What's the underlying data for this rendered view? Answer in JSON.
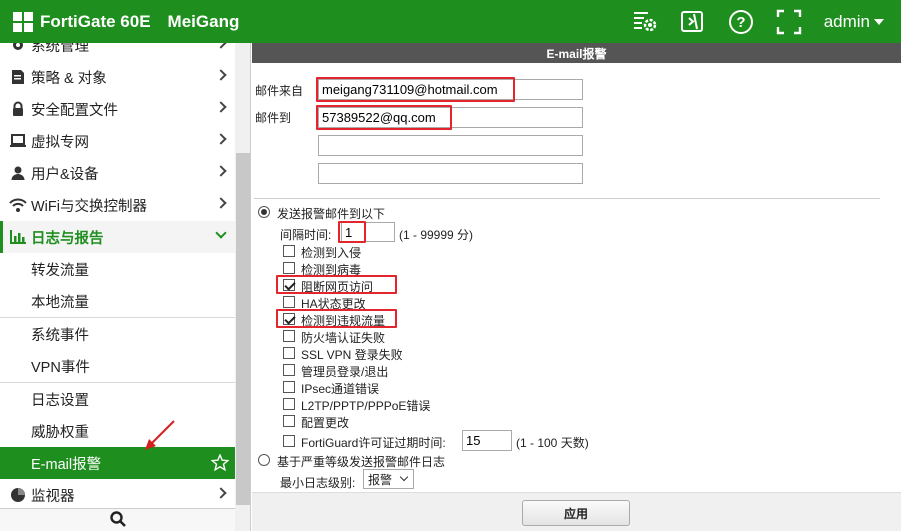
{
  "topbar": {
    "product": "FortiGate 60E",
    "hostname": "MeiGang",
    "icons": [
      "cli-settings-icon",
      "video-icon",
      "help-icon",
      "fullscreen-icon"
    ],
    "user": "admin"
  },
  "sidebar": {
    "items": [
      {
        "label": "系统管理",
        "icon": "gear-icon"
      },
      {
        "label": "策略 & 对象",
        "icon": "policy-icon"
      },
      {
        "label": "安全配置文件",
        "icon": "lock-icon"
      },
      {
        "label": "虚拟专网",
        "icon": "laptop-icon"
      },
      {
        "label": "用户&设备",
        "icon": "user-icon"
      },
      {
        "label": "WiFi与交换控制器",
        "icon": "wifi-icon"
      },
      {
        "label": "日志与报告",
        "icon": "bar-chart-icon"
      }
    ],
    "log_sub": [
      "转发流量",
      "本地流量",
      "系统事件",
      "VPN事件",
      "日志设置",
      "威胁权重",
      "E-mail报警"
    ],
    "monitor": {
      "label": "监视器",
      "icon": "pie-chart-icon"
    }
  },
  "main": {
    "title": "E-mail报警",
    "email_from_label": "邮件来自",
    "email_from": "meigang731109@hotmail.com",
    "email_to_label": "邮件到",
    "email_to": [
      "57389522@qq.com",
      "",
      ""
    ],
    "send_option_label": "发送报警邮件到以下",
    "interval_label": "间隔时间:",
    "interval_value": "1",
    "interval_range": "(1 - 99999 分)",
    "events": [
      {
        "label": "检测到入侵",
        "checked": false
      },
      {
        "label": "检测到病毒",
        "checked": false
      },
      {
        "label": "阻断网页访问",
        "checked": true
      },
      {
        "label": "HA状态更改",
        "checked": false
      },
      {
        "label": "检测到违规流量",
        "checked": true
      },
      {
        "label": "防火墙认证失败",
        "checked": false
      },
      {
        "label": "SSL VPN 登录失败",
        "checked": false
      },
      {
        "label": "管理员登录/退出",
        "checked": false
      },
      {
        "label": "IPsec通道错误",
        "checked": false
      },
      {
        "label": "L2TP/PPTP/PPPoE错误",
        "checked": false
      },
      {
        "label": "配置更改",
        "checked": false
      }
    ],
    "fortiguard_label": "FortiGuard许可证过期时间:",
    "fortiguard_value": "15",
    "fortiguard_range": "(1 - 100 天数)",
    "severity_option_label": "基于严重等级发送报警邮件日志",
    "min_level_label": "最小日志级别:",
    "min_level_value": "报警",
    "apply_label": "应用"
  },
  "colors": {
    "brand_green": "#1e8f1e",
    "highlight_red": "#e3262e",
    "title_bar": "#555555"
  }
}
